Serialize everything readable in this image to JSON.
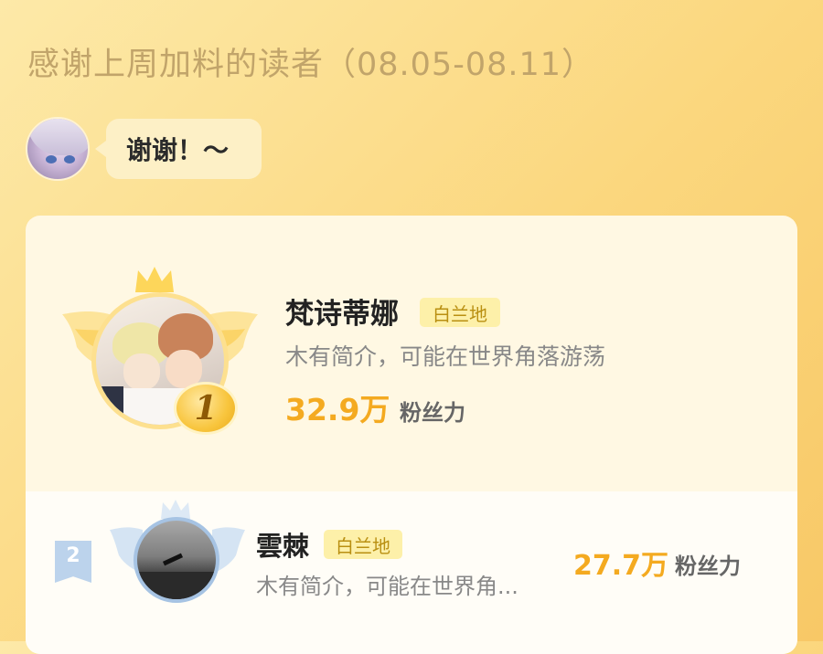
{
  "header": {
    "title": "感谢上周加料的读者（08.05-08.11）"
  },
  "greeting": {
    "text": "谢谢！～"
  },
  "ranking": [
    {
      "rank": "1",
      "name": "梵诗蒂娜",
      "tag": "白兰地",
      "bio": "木有简介，可能在世界角落游荡",
      "fans_value": "32.9万",
      "fans_label": "粉丝力"
    },
    {
      "rank": "2",
      "name": "雲棘",
      "tag": "白兰地",
      "bio": "木有简介，可能在世界角...",
      "fans_value": "27.7万",
      "fans_label": "粉丝力"
    }
  ],
  "colors": {
    "accent": "#f4aa20",
    "tag_bg": "#fdf0a9",
    "tag_text": "#b98f11",
    "background": "#fbd77e"
  }
}
